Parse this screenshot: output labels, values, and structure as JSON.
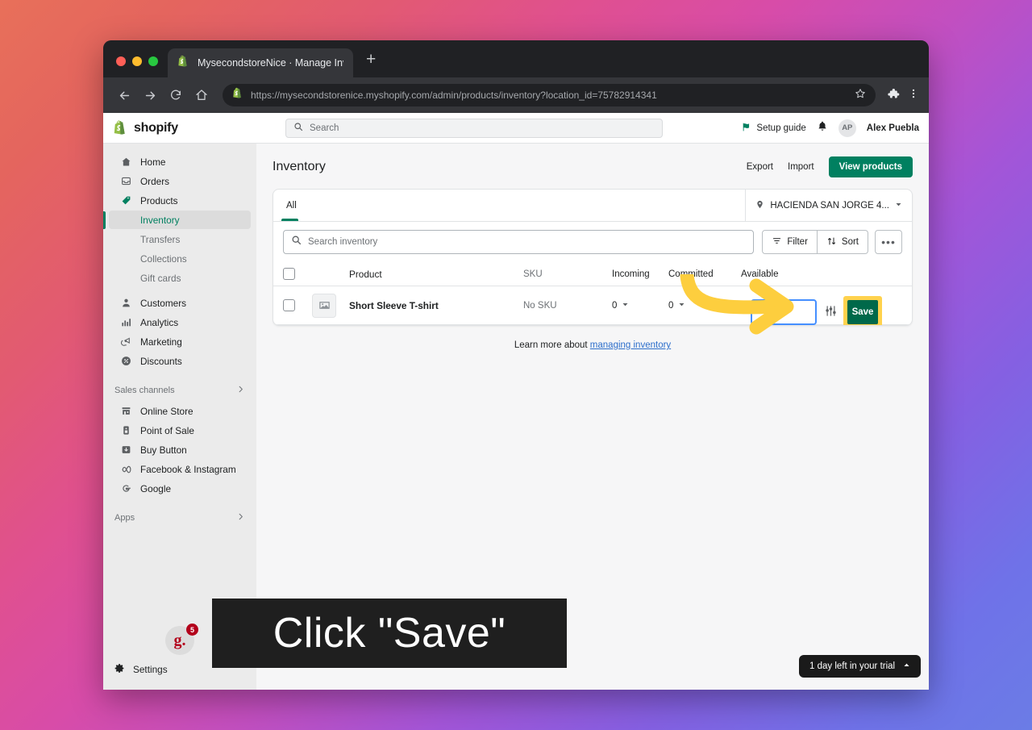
{
  "browser": {
    "tab_title": "MysecondstoreNice · Manage Inv",
    "tab_favicon": "shopify-icon",
    "new_tab_label": "+",
    "url": "https://mysecondstorenice.myshopify.com/admin/products/inventory?location_id=75782914341",
    "back_icon": "back-arrow-icon",
    "forward_icon": "forward-arrow-icon",
    "reload_icon": "reload-icon",
    "home_icon": "home-icon",
    "bookmark_icon": "star-icon",
    "extensions_icon": "puzzle-icon",
    "menu_icon": "kebab-menu-icon"
  },
  "topbar": {
    "brand": "shopify",
    "search_placeholder": "Search",
    "setup_guide": "Setup guide",
    "notifications_icon": "bell-icon",
    "avatar_initials": "AP",
    "user_name": "Alex Puebla"
  },
  "sidebar": {
    "items": [
      {
        "label": "Home",
        "icon": "home-icon"
      },
      {
        "label": "Orders",
        "icon": "orders-inbox-icon"
      },
      {
        "label": "Products",
        "icon": "product-tag-icon"
      }
    ],
    "product_subitems": [
      {
        "label": "Inventory",
        "active": true
      },
      {
        "label": "Transfers",
        "active": false
      },
      {
        "label": "Collections",
        "active": false
      },
      {
        "label": "Gift cards",
        "active": false
      }
    ],
    "items2": [
      {
        "label": "Customers",
        "icon": "person-icon"
      },
      {
        "label": "Analytics",
        "icon": "bar-chart-icon"
      },
      {
        "label": "Marketing",
        "icon": "megaphone-icon"
      },
      {
        "label": "Discounts",
        "icon": "discount-tag-icon"
      }
    ],
    "sales_channels_label": "Sales channels",
    "sales_channels": [
      {
        "label": "Online Store",
        "icon": "storefront-icon"
      },
      {
        "label": "Point of Sale",
        "icon": "pos-icon"
      },
      {
        "label": "Buy Button",
        "icon": "buy-button-icon"
      },
      {
        "label": "Facebook & Instagram",
        "icon": "meta-icon"
      },
      {
        "label": "Google",
        "icon": "google-icon"
      }
    ],
    "apps_label": "Apps",
    "bottom_avatar_letter": "g.",
    "bottom_badge_count": "5",
    "settings_label": "Settings",
    "settings_icon": "gear-icon"
  },
  "page": {
    "title": "Inventory",
    "export_label": "Export",
    "import_label": "Import",
    "view_products_label": "View products"
  },
  "card": {
    "tab_all": "All",
    "location_icon": "map-pin-icon",
    "location_value": "HACIENDA SAN JORGE 4...",
    "search_placeholder": "Search inventory",
    "filter_label": "Filter",
    "sort_label": "Sort",
    "more_label": "•••",
    "columns": [
      "Product",
      "SKU",
      "Incoming",
      "Committed",
      "Available"
    ],
    "rows": [
      {
        "product": "Short Sleeve T-shirt",
        "thumb_icon": "image-placeholder-icon",
        "sku": "No SKU",
        "incoming": "0",
        "committed": "0",
        "available_value": "",
        "adjust_icon": "sliders-icon",
        "save_label": "Save"
      }
    ]
  },
  "footer": {
    "learn_more_prefix": "Learn more about ",
    "learn_more_link": "managing inventory"
  },
  "overlay": {
    "caption": "Click \"Save\"",
    "arrow_icon": "curved-arrow-right-icon",
    "highlight_color": "#ffd24d"
  },
  "trial": {
    "text": "1 day left in your trial",
    "chevron": "chevron-up-icon"
  }
}
